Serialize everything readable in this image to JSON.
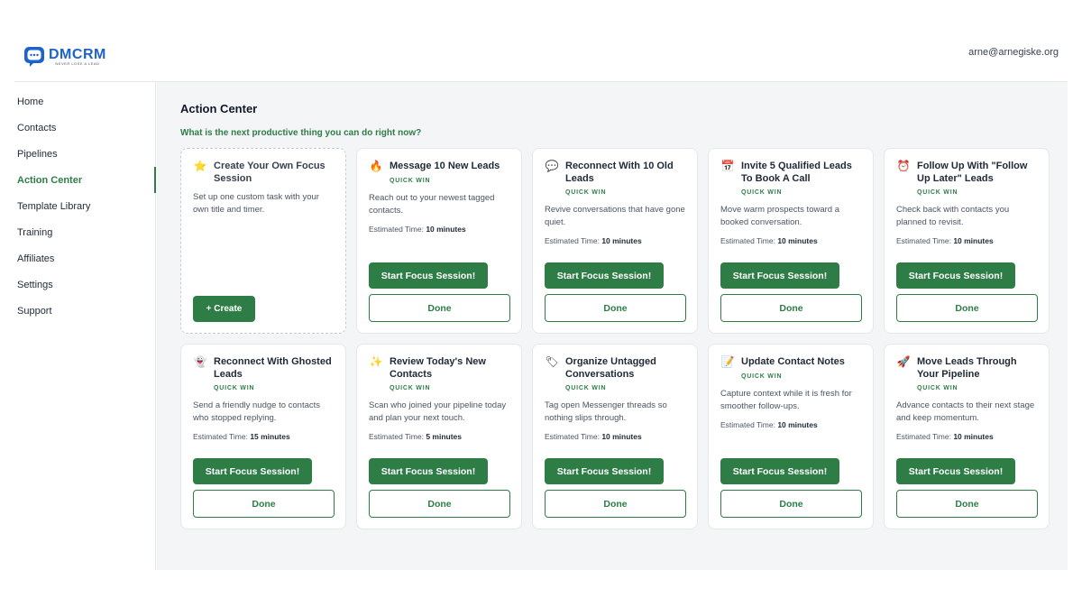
{
  "app": {
    "logo_text_a": "DM",
    "logo_text_b": "CRM",
    "logo_tagline": "NEVER LOSE A LEAD",
    "brand_color": "#1e63c9",
    "accent_color": "#2e7d46",
    "user_email": "arne@arnegiske.org"
  },
  "sidebar": {
    "items": [
      {
        "label": "Home"
      },
      {
        "label": "Contacts"
      },
      {
        "label": "Pipelines"
      },
      {
        "label": "Action Center",
        "active": true
      },
      {
        "label": "Template Library"
      },
      {
        "label": "Training"
      },
      {
        "label": "Affiliates"
      },
      {
        "label": "Settings"
      },
      {
        "label": "Support"
      }
    ]
  },
  "main": {
    "title": "Action Center",
    "subtitle": "What is the next productive thing you can do right now?",
    "custom_card": {
      "icon": "star-icon",
      "glyph": "⭐",
      "title": "Create Your Own Focus Session",
      "description": "Set up one custom task with your own title and timer.",
      "button": "+ Create"
    },
    "badge": "QUICK WIN",
    "est_label": "Estimated Time:",
    "start_label": "Start Focus Session!",
    "done_label": "Done",
    "cards": [
      {
        "icon": "fire-icon",
        "glyph": "🔥",
        "title": "Message 10 New Leads",
        "description": "Reach out to your newest tagged contacts.",
        "time": "10 minutes"
      },
      {
        "icon": "speech-bubble-icon",
        "glyph": "💬",
        "title": "Reconnect With 10 Old Leads",
        "description": "Revive conversations that have gone quiet.",
        "time": "10 minutes"
      },
      {
        "icon": "calendar-icon",
        "glyph": "📅",
        "title": "Invite 5 Qualified Leads To Book A Call",
        "description": "Move warm prospects toward a booked conversation.",
        "time": "10 minutes"
      },
      {
        "icon": "alarm-clock-icon",
        "glyph": "⏰",
        "title": "Follow Up With \"Follow Up Later\" Leads",
        "description": "Check back with contacts you planned to revisit.",
        "time": "10 minutes"
      },
      {
        "icon": "ghost-icon",
        "glyph": "👻",
        "title": "Reconnect With Ghosted Leads",
        "description": "Send a friendly nudge to contacts who stopped replying.",
        "time": "15 minutes"
      },
      {
        "icon": "sparkles-icon",
        "glyph": "✨",
        "title": "Review Today's New Contacts",
        "description": "Scan who joined your pipeline today and plan your next touch.",
        "time": "5 minutes"
      },
      {
        "icon": "label-tag-icon",
        "glyph": "🏷",
        "title": "Organize Untagged Conversations",
        "description": "Tag open Messenger threads so nothing slips through.",
        "time": "10 minutes"
      },
      {
        "icon": "memo-icon",
        "glyph": "📝",
        "title": "Update Contact Notes",
        "description": "Capture context while it is fresh for smoother follow-ups.",
        "time": "10 minutes"
      },
      {
        "icon": "rocket-icon",
        "glyph": "🚀",
        "title": "Move Leads Through Your Pipeline",
        "description": "Advance contacts to their next stage and keep momentum.",
        "time": "10 minutes"
      }
    ]
  }
}
